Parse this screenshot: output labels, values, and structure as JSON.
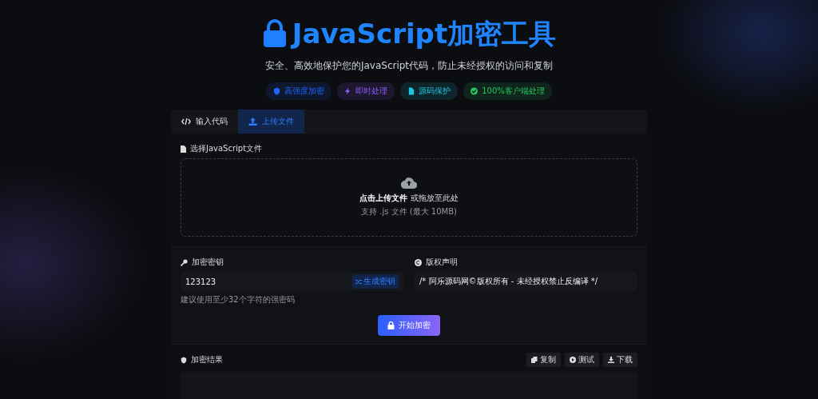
{
  "header": {
    "title": "JavaScript加密工具",
    "subtitle": "安全、高效地保护您的JavaScript代码，防止未经授权的访问和复制"
  },
  "badges": [
    {
      "label": "高强度加密",
      "kind": "shield",
      "color": "#1e66ff"
    },
    {
      "label": "即时处理",
      "kind": "bolt",
      "color": "#8b5cf6"
    },
    {
      "label": "源码保护",
      "kind": "file",
      "color": "#22c5e0"
    },
    {
      "label": "100%客户端处理",
      "kind": "check",
      "color": "#22c55e"
    }
  ],
  "tabs": [
    {
      "label": "输入代码",
      "kind": "code",
      "selected": false
    },
    {
      "label": "上传文件",
      "kind": "upload",
      "selected": true
    }
  ],
  "upload": {
    "label": "选择JavaScript文件",
    "prompt": "点击上传文件",
    "prompt_rest": "或拖放至此处",
    "hint": "支持 .js 文件 (最大 10MB)"
  },
  "key": {
    "label": "加密密钥",
    "value": "123123",
    "generate_button": "生成密钥",
    "hint": "建议使用至少32个字符的强密码"
  },
  "copyright": {
    "label": "版权声明",
    "value": "/* 阿乐源码网©版权所有 - 未经授权禁止反编译 */"
  },
  "encrypt_button": "开始加密",
  "result": {
    "label": "加密结果",
    "actions": [
      {
        "label": "复制",
        "kind": "copy"
      },
      {
        "label": "测试",
        "kind": "play"
      },
      {
        "label": "下载",
        "kind": "download"
      }
    ]
  }
}
